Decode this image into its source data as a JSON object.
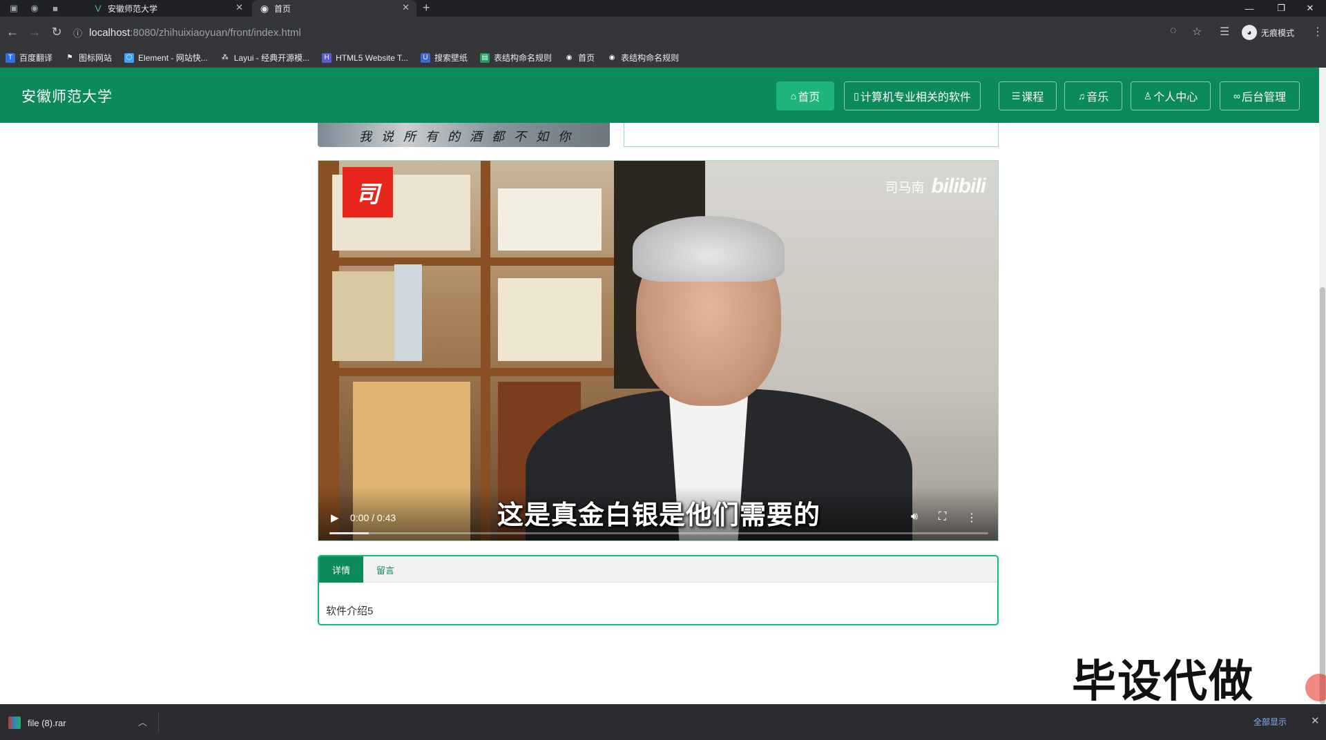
{
  "browser": {
    "tabs": [
      {
        "title": "安徽师范大学",
        "active": false
      },
      {
        "title": "首页",
        "active": true
      }
    ],
    "url_host": "localhost",
    "url_path": ":8080/zhihuixiaoyuan/front/index.html",
    "incognito_label": "无痕模式",
    "bookmarks": [
      "百度翻译",
      "图标网站",
      "Element - 网站快...",
      "Layui - 经典开源模...",
      "HTML5 Website T...",
      "搜索壁纸",
      "表结构命名规则",
      "首页",
      "表结构命名规则"
    ]
  },
  "site": {
    "title": "安徽师范大学",
    "nav": [
      {
        "label": "首页",
        "icon": "home-icon",
        "active": true
      },
      {
        "label": "计算机专业相关的软件",
        "icon": "book-icon",
        "active": false
      },
      {
        "label": "课程",
        "icon": "layers-icon",
        "active": false
      },
      {
        "label": "音乐",
        "icon": "music-icon",
        "active": false
      },
      {
        "label": "个人中心",
        "icon": "user-icon",
        "active": false
      },
      {
        "label": "后台管理",
        "icon": "link-icon",
        "active": false
      }
    ]
  },
  "content": {
    "thumb_caption": "我说所有的酒都不如你",
    "video": {
      "logo_char": "司",
      "watermark_name": "司马南",
      "watermark_logo": "bilibili",
      "subtitle": "这是真金白银是他们需要的",
      "time": "0:00 / 0:43",
      "progress_fraction": 0.06
    },
    "tabs": [
      {
        "label": "详情",
        "active": true
      },
      {
        "label": "留言",
        "active": false
      }
    ],
    "detail_text": "软件介绍5"
  },
  "overlay_text": "毕设代做",
  "downloads": {
    "file": "file (8).rar",
    "show_all": "全部显示"
  },
  "colors": {
    "header_green": "#0b8a5a",
    "nav_active": "#1fb47a",
    "card_border": "#1fb47a"
  }
}
